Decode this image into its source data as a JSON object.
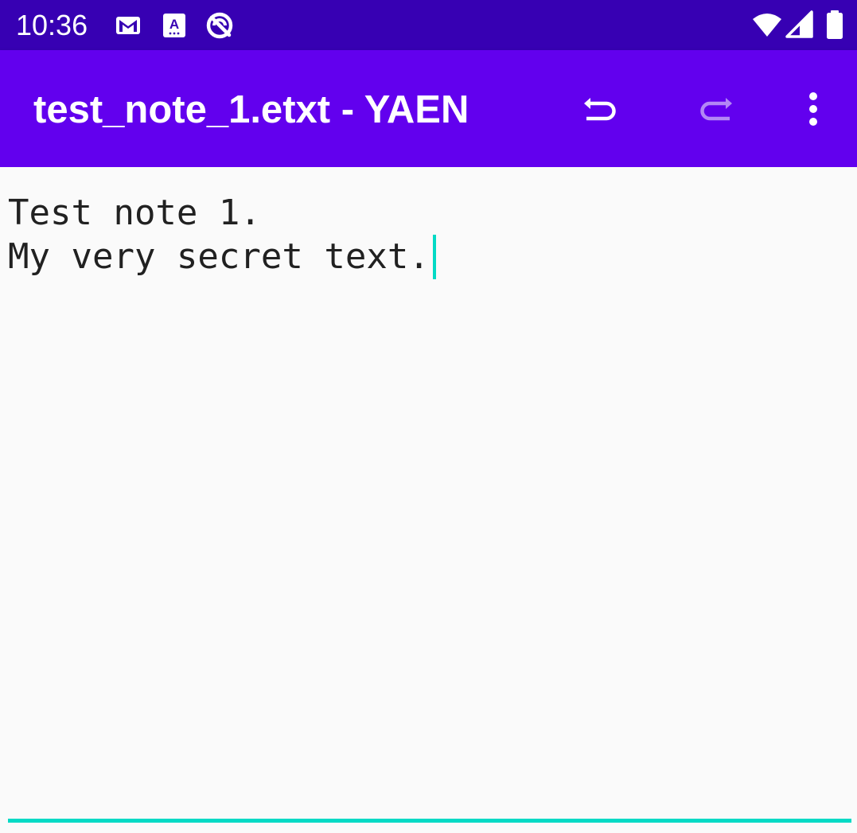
{
  "status_bar": {
    "time": "10:36",
    "icons": [
      "gmail-icon",
      "font-a-icon",
      "no-sync-icon",
      "wifi-icon",
      "signal-icon",
      "battery-icon"
    ]
  },
  "app_bar": {
    "title": "test_note_1.etxt - YAEN",
    "actions": [
      "undo-icon",
      "redo-icon",
      "more-vert-icon"
    ],
    "background": "#6200EE"
  },
  "editor": {
    "lines": [
      "Test note 1.",
      "My very secret text."
    ],
    "accent": "#03DAC5"
  }
}
